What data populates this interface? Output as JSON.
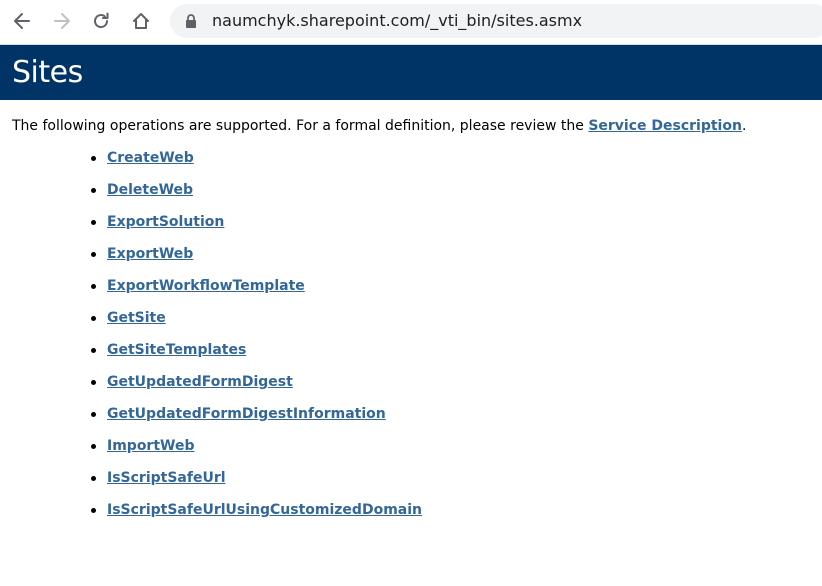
{
  "browser": {
    "url": "naumchyk.sharepoint.com/_vti_bin/sites.asmx",
    "icons": {
      "back": "back-arrow-icon",
      "forward": "forward-arrow-icon",
      "reload": "reload-icon",
      "home": "home-icon",
      "lock": "lock-icon"
    }
  },
  "page": {
    "title": "Sites",
    "banner_color": "#003366",
    "link_color": "#336699",
    "intro_text": "The following operations are supported. For a formal definition, please review the",
    "service_link": "Service Description",
    "intro_end": "."
  },
  "operations": [
    "CreateWeb",
    "DeleteWeb",
    "ExportSolution",
    "ExportWeb",
    "ExportWorkflowTemplate",
    "GetSite",
    "GetSiteTemplates",
    "GetUpdatedFormDigest",
    "GetUpdatedFormDigestInformation",
    "ImportWeb",
    "IsScriptSafeUrl",
    "IsScriptSafeUrlUsingCustomizedDomain"
  ]
}
